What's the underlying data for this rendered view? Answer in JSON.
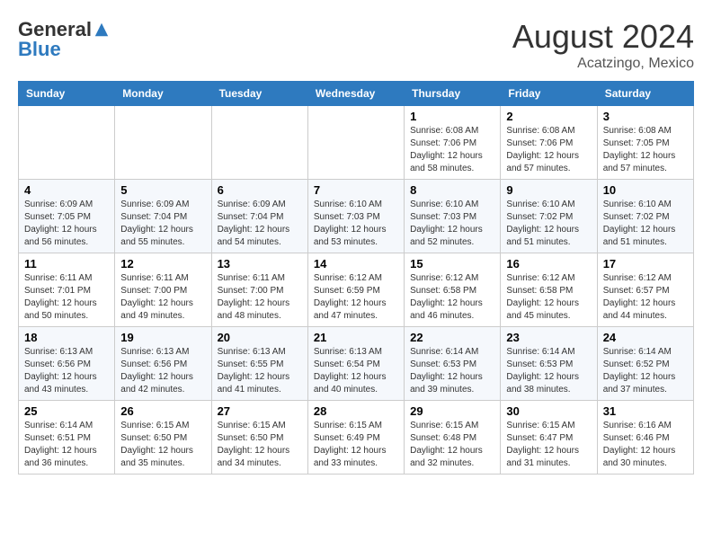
{
  "header": {
    "logo_general": "General",
    "logo_blue": "Blue",
    "month_year": "August 2024",
    "location": "Acatzingo, Mexico"
  },
  "weekdays": [
    "Sunday",
    "Monday",
    "Tuesday",
    "Wednesday",
    "Thursday",
    "Friday",
    "Saturday"
  ],
  "weeks": [
    [
      {
        "day": "",
        "info": ""
      },
      {
        "day": "",
        "info": ""
      },
      {
        "day": "",
        "info": ""
      },
      {
        "day": "",
        "info": ""
      },
      {
        "day": "1",
        "info": "Sunrise: 6:08 AM\nSunset: 7:06 PM\nDaylight: 12 hours\nand 58 minutes."
      },
      {
        "day": "2",
        "info": "Sunrise: 6:08 AM\nSunset: 7:06 PM\nDaylight: 12 hours\nand 57 minutes."
      },
      {
        "day": "3",
        "info": "Sunrise: 6:08 AM\nSunset: 7:05 PM\nDaylight: 12 hours\nand 57 minutes."
      }
    ],
    [
      {
        "day": "4",
        "info": "Sunrise: 6:09 AM\nSunset: 7:05 PM\nDaylight: 12 hours\nand 56 minutes."
      },
      {
        "day": "5",
        "info": "Sunrise: 6:09 AM\nSunset: 7:04 PM\nDaylight: 12 hours\nand 55 minutes."
      },
      {
        "day": "6",
        "info": "Sunrise: 6:09 AM\nSunset: 7:04 PM\nDaylight: 12 hours\nand 54 minutes."
      },
      {
        "day": "7",
        "info": "Sunrise: 6:10 AM\nSunset: 7:03 PM\nDaylight: 12 hours\nand 53 minutes."
      },
      {
        "day": "8",
        "info": "Sunrise: 6:10 AM\nSunset: 7:03 PM\nDaylight: 12 hours\nand 52 minutes."
      },
      {
        "day": "9",
        "info": "Sunrise: 6:10 AM\nSunset: 7:02 PM\nDaylight: 12 hours\nand 51 minutes."
      },
      {
        "day": "10",
        "info": "Sunrise: 6:10 AM\nSunset: 7:02 PM\nDaylight: 12 hours\nand 51 minutes."
      }
    ],
    [
      {
        "day": "11",
        "info": "Sunrise: 6:11 AM\nSunset: 7:01 PM\nDaylight: 12 hours\nand 50 minutes."
      },
      {
        "day": "12",
        "info": "Sunrise: 6:11 AM\nSunset: 7:00 PM\nDaylight: 12 hours\nand 49 minutes."
      },
      {
        "day": "13",
        "info": "Sunrise: 6:11 AM\nSunset: 7:00 PM\nDaylight: 12 hours\nand 48 minutes."
      },
      {
        "day": "14",
        "info": "Sunrise: 6:12 AM\nSunset: 6:59 PM\nDaylight: 12 hours\nand 47 minutes."
      },
      {
        "day": "15",
        "info": "Sunrise: 6:12 AM\nSunset: 6:58 PM\nDaylight: 12 hours\nand 46 minutes."
      },
      {
        "day": "16",
        "info": "Sunrise: 6:12 AM\nSunset: 6:58 PM\nDaylight: 12 hours\nand 45 minutes."
      },
      {
        "day": "17",
        "info": "Sunrise: 6:12 AM\nSunset: 6:57 PM\nDaylight: 12 hours\nand 44 minutes."
      }
    ],
    [
      {
        "day": "18",
        "info": "Sunrise: 6:13 AM\nSunset: 6:56 PM\nDaylight: 12 hours\nand 43 minutes."
      },
      {
        "day": "19",
        "info": "Sunrise: 6:13 AM\nSunset: 6:56 PM\nDaylight: 12 hours\nand 42 minutes."
      },
      {
        "day": "20",
        "info": "Sunrise: 6:13 AM\nSunset: 6:55 PM\nDaylight: 12 hours\nand 41 minutes."
      },
      {
        "day": "21",
        "info": "Sunrise: 6:13 AM\nSunset: 6:54 PM\nDaylight: 12 hours\nand 40 minutes."
      },
      {
        "day": "22",
        "info": "Sunrise: 6:14 AM\nSunset: 6:53 PM\nDaylight: 12 hours\nand 39 minutes."
      },
      {
        "day": "23",
        "info": "Sunrise: 6:14 AM\nSunset: 6:53 PM\nDaylight: 12 hours\nand 38 minutes."
      },
      {
        "day": "24",
        "info": "Sunrise: 6:14 AM\nSunset: 6:52 PM\nDaylight: 12 hours\nand 37 minutes."
      }
    ],
    [
      {
        "day": "25",
        "info": "Sunrise: 6:14 AM\nSunset: 6:51 PM\nDaylight: 12 hours\nand 36 minutes."
      },
      {
        "day": "26",
        "info": "Sunrise: 6:15 AM\nSunset: 6:50 PM\nDaylight: 12 hours\nand 35 minutes."
      },
      {
        "day": "27",
        "info": "Sunrise: 6:15 AM\nSunset: 6:50 PM\nDaylight: 12 hours\nand 34 minutes."
      },
      {
        "day": "28",
        "info": "Sunrise: 6:15 AM\nSunset: 6:49 PM\nDaylight: 12 hours\nand 33 minutes."
      },
      {
        "day": "29",
        "info": "Sunrise: 6:15 AM\nSunset: 6:48 PM\nDaylight: 12 hours\nand 32 minutes."
      },
      {
        "day": "30",
        "info": "Sunrise: 6:15 AM\nSunset: 6:47 PM\nDaylight: 12 hours\nand 31 minutes."
      },
      {
        "day": "31",
        "info": "Sunrise: 6:16 AM\nSunset: 6:46 PM\nDaylight: 12 hours\nand 30 minutes."
      }
    ]
  ]
}
